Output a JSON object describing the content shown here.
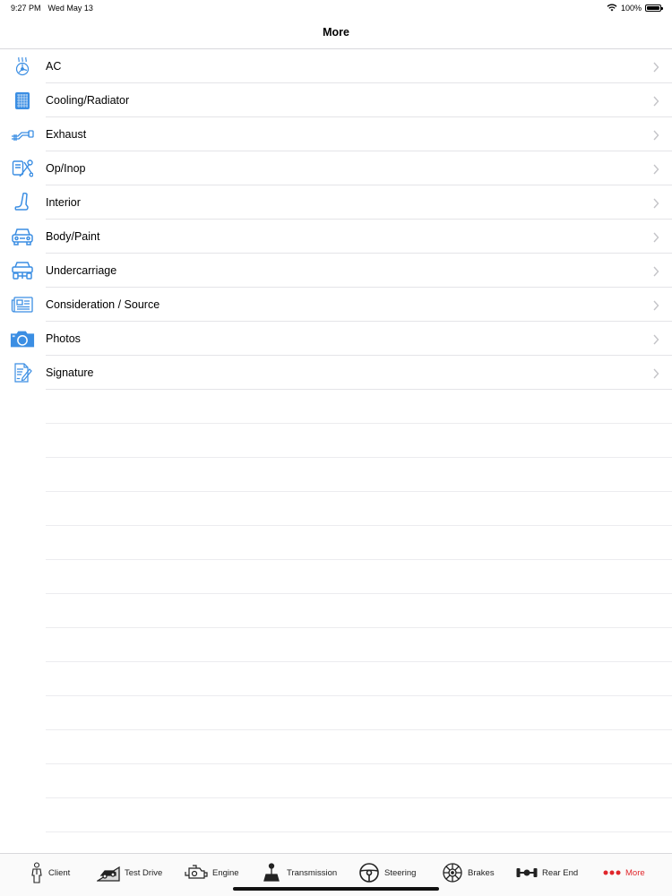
{
  "status_bar": {
    "time": "9:27 PM",
    "date": "Wed May 13",
    "battery_percent": "100%",
    "wifi_icon": "wifi-icon",
    "battery_icon": "battery-icon"
  },
  "nav": {
    "title": "More"
  },
  "colors": {
    "accent": "#e0262b",
    "icon_blue": "#3b8ee3"
  },
  "list": [
    {
      "label": "AC",
      "icon": "ac-fan-icon"
    },
    {
      "label": "Cooling/Radiator",
      "icon": "radiator-icon"
    },
    {
      "label": "Exhaust",
      "icon": "exhaust-icon"
    },
    {
      "label": "Op/Inop",
      "icon": "tools-icon"
    },
    {
      "label": "Interior",
      "icon": "seat-icon"
    },
    {
      "label": "Body/Paint",
      "icon": "car-body-icon"
    },
    {
      "label": "Undercarriage",
      "icon": "undercarriage-icon"
    },
    {
      "label": "Consideration / Source",
      "icon": "newspaper-icon"
    },
    {
      "label": "Photos",
      "icon": "camera-icon"
    },
    {
      "label": "Signature",
      "icon": "signature-icon"
    }
  ],
  "tabs": [
    {
      "label": "Client",
      "icon": "person-icon"
    },
    {
      "label": "Test Drive",
      "icon": "test-drive-icon"
    },
    {
      "label": "Engine",
      "icon": "engine-icon"
    },
    {
      "label": "Transmission",
      "icon": "gear-shift-icon"
    },
    {
      "label": "Steering",
      "icon": "steering-wheel-icon"
    },
    {
      "label": "Brakes",
      "icon": "brake-disc-icon"
    },
    {
      "label": "Rear End",
      "icon": "axle-icon"
    },
    {
      "label": "More",
      "icon": "more-dots-icon",
      "active": true
    }
  ]
}
